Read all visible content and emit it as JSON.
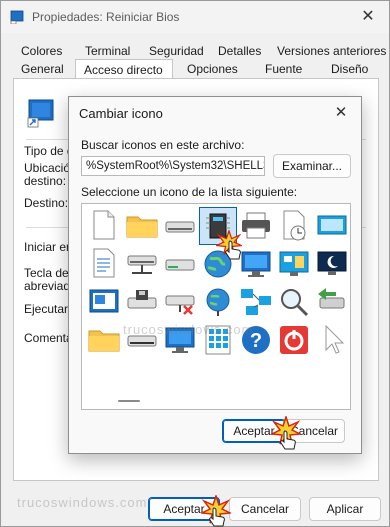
{
  "window": {
    "title": "Propiedades: Reiniciar Bios",
    "close_glyph": "✕"
  },
  "tabs_row1": [
    "Colores",
    "Terminal",
    "Seguridad",
    "Detalles",
    "Versiones anteriores"
  ],
  "tabs_row2": [
    "General",
    "Acceso directo",
    "Opciones",
    "Fuente",
    "Diseño"
  ],
  "active_tab": "Acceso directo",
  "panel": {
    "tipo_label": "Tipo de de",
    "ubicacion_label": "Ubicación",
    "destino_label_line2": "destino:",
    "destino_label": "Destino:",
    "iniciar_label": "Iniciar en:",
    "tecla_label": "Tecla de m",
    "abreviado_label": "abreviado",
    "ejecutar_label": "Ejecutar:",
    "comentario_label": "Comentari"
  },
  "dialog": {
    "title": "Cambiar icono",
    "close_glyph": "✕",
    "search_label": "Buscar iconos en este archivo:",
    "path_value": "%SystemRoot%\\System32\\SHELL32.dll",
    "browse_button": "Examinar...",
    "list_label": "Seleccione un icono de la lista siguiente:",
    "ok_button": "Aceptar",
    "cancel_button": "Cancelar"
  },
  "icons": [
    {
      "name": "blank-document-icon"
    },
    {
      "name": "folder-icon"
    },
    {
      "name": "drive-icon"
    },
    {
      "name": "chip-icon",
      "selected": true
    },
    {
      "name": "printer-icon"
    },
    {
      "name": "clock-document-icon"
    },
    {
      "name": "monitor-window-icon"
    },
    {
      "name": "text-document-icon"
    },
    {
      "name": "network-drive-icon"
    },
    {
      "name": "drive-green-icon"
    },
    {
      "name": "globe-icon"
    },
    {
      "name": "monitor-display-icon"
    },
    {
      "name": "control-panel-icon"
    },
    {
      "name": "moon-monitor-icon"
    },
    {
      "name": "window-list-icon"
    },
    {
      "name": "floppy-drive-icon"
    },
    {
      "name": "disconnected-drive-icon"
    },
    {
      "name": "network-globe-icon"
    },
    {
      "name": "network-icon"
    },
    {
      "name": "search-icon"
    },
    {
      "name": "usb-device-icon"
    },
    {
      "name": "folder-open-icon"
    },
    {
      "name": "drive-dark-icon"
    },
    {
      "name": "monitor-blue-icon"
    },
    {
      "name": "calculator-grid-icon"
    },
    {
      "name": "help-icon"
    },
    {
      "name": "power-icon"
    },
    {
      "name": "cursor-icon"
    }
  ],
  "bottom_buttons": {
    "ok": "Aceptar",
    "cancel": "Cancelar",
    "apply": "Aplicar"
  },
  "watermark": "trucoswindows.com",
  "colors": {
    "accent": "#005fb8",
    "selection": "#cce4f7"
  }
}
